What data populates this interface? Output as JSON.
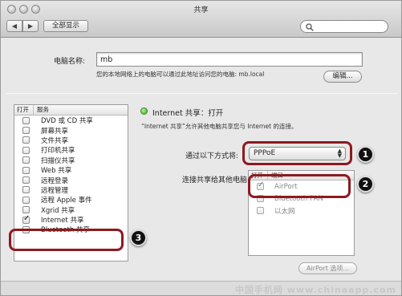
{
  "window": {
    "title": "共享"
  },
  "toolbar": {
    "back_glyph": "◀",
    "forward_glyph": "▶",
    "show_all_label": "全部显示",
    "search_value": ""
  },
  "computer_name": {
    "label": "电脑名称:",
    "value": "mb",
    "help_text": "您的本地网络上的电脑可以通过此地址访问您的电脑: mb.local",
    "edit_button_label": "编辑..."
  },
  "services": {
    "header_on": "打开",
    "header_service": "服务",
    "items": [
      {
        "label": "DVD 或 CD 共享",
        "checked": false
      },
      {
        "label": "屏幕共享",
        "checked": false
      },
      {
        "label": "文件共享",
        "checked": false
      },
      {
        "label": "打印机共享",
        "checked": false
      },
      {
        "label": "扫描仪共享",
        "checked": false
      },
      {
        "label": "Web 共享",
        "checked": false
      },
      {
        "label": "远程登录",
        "checked": false
      },
      {
        "label": "远程管理",
        "checked": false
      },
      {
        "label": "远程 Apple 事件",
        "checked": false
      },
      {
        "label": "Xgrid 共享",
        "checked": false
      },
      {
        "label": "Internet 共享",
        "checked": true
      },
      {
        "label": "Bluetooth 共享",
        "checked": false
      }
    ]
  },
  "internet_sharing": {
    "status_title": "Internet 共享：打开",
    "description": "“Internet 共享”允许其他电脑共享您与 Internet 的连接。",
    "share_from_label": "通过以下方式将:",
    "share_from_value": "PPPoE",
    "share_to_label": "连接共享给其他电脑:",
    "ports_header_on": "打开",
    "ports_header_port": "端口",
    "ports": [
      {
        "label": "AirPort",
        "checked": true
      },
      {
        "label": "Bluetooth PAN",
        "checked": false
      },
      {
        "label": "以太网",
        "checked": false
      }
    ],
    "airport_options_label": "AirPort 选项..."
  },
  "callouts": {
    "one": "1",
    "two": "2",
    "three": "3"
  },
  "watermark": "中国手机网 www.chinaapp.com",
  "colors": {
    "highlight": "#8d1a1f",
    "status_on": "#3aa521"
  }
}
